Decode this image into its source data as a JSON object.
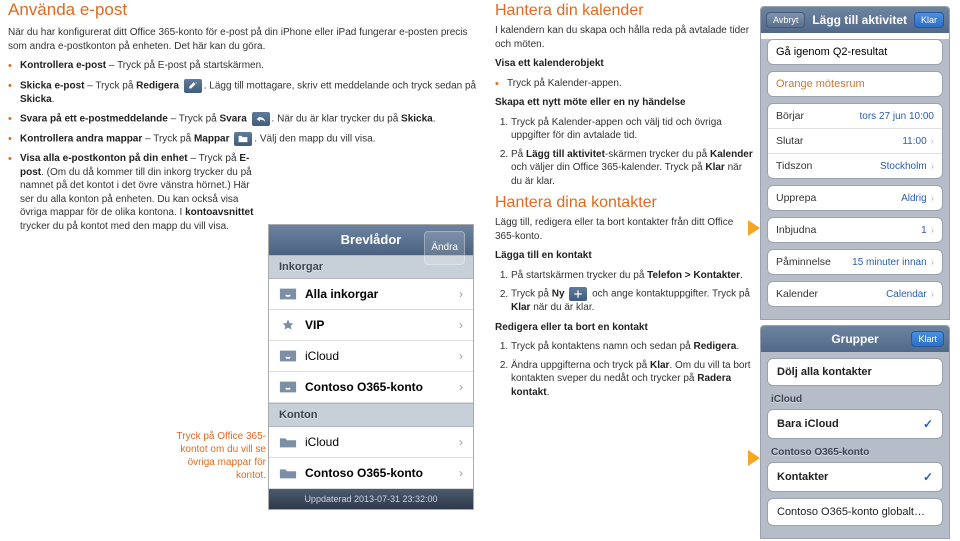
{
  "left": {
    "title": "Använda e-post",
    "intro": "När du har konfigurerat ditt Office 365-konto för e-post på din iPhone eller iPad fungerar e-posten precis som andra e-postkonton på enheten. Det här kan du göra.",
    "b1_a": "Kontrollera e-post",
    "b1_b": " – Tryck på E-post på startskärmen.",
    "b2_a": "Skicka e-post",
    "b2_b": " – Tryck på ",
    "b2_c": "Redigera",
    "b2_d": ". Lägg till mottagare, skriv ett meddelande och tryck sedan på ",
    "b2_e": "Skicka",
    "b2_f": ".",
    "b3_a": "Svara på ett e-postmeddelande",
    "b3_b": " – Tryck på ",
    "b3_c": "Svara",
    "b3_d": ". När du är klar trycker du på ",
    "b3_e": "Skicka",
    "b3_f": ".",
    "b4_a": "Kontrollera andra mappar",
    "b4_b": " – Tryck på ",
    "b4_c": "Mappar",
    "b4_d": ". Välj den mapp du vill visa.",
    "b5_a": "Visa alla e-postkonton på din enhet",
    "b5_b": " – Tryck på ",
    "b5_c": "E-post",
    "b5_d": ". (Om du då kommer till din inkorg trycker du på namnet på det kontot i det övre vänstra hörnet.) Här ser du alla konton på enheten. Du kan också visa övriga mappar för de olika kontona. I ",
    "b5_e": "kontoavsnittet",
    "b5_f": " trycker du på kontot med den mapp du vill visa.",
    "callout": "Tryck på Office 365-kontot om du vill se övriga mappar för kontot."
  },
  "mailboxes": {
    "title": "Brevlådor",
    "edit": "Ändra",
    "sec1": "Inkorgar",
    "rows1": [
      "Alla inkorgar",
      "VIP",
      "iCloud",
      "Contoso O365-konto"
    ],
    "sec2": "Konton",
    "rows2": [
      "iCloud",
      "Contoso O365-konto"
    ],
    "footer": "Uppdaterad 2013-07-31 23:32:00"
  },
  "mid": {
    "h1a": "Hantera din kalender",
    "p1": "I kalendern kan du skapa och hålla reda på avtalade tider och möten.",
    "s1": "Visa ett kalenderobjekt",
    "li1": "Tryck på Kalender-appen.",
    "s2": "Skapa ett nytt möte eller en ny händelse",
    "ol1_1": "Tryck på Kalender-appen och välj tid och övriga uppgifter för din avtalade tid.",
    "ol1_2a": "På ",
    "ol1_2b": "Lägg till aktivitet",
    "ol1_2c": "-skärmen trycker du på ",
    "ol1_2d": "Kalender",
    "ol1_2e": " och väljer din Office 365-kalender. Tryck på ",
    "ol1_2f": "Klar",
    "ol1_2g": " när du är klar.",
    "h1b": "Hantera dina kontakter",
    "p2": "Lägg till, redigera eller ta bort kontakter från ditt Office 365-konto.",
    "s3": "Lägga till en kontakt",
    "ol2_1a": "På startskärmen trycker du på ",
    "ol2_1b": "Telefon > Kontakter",
    "ol2_1c": ".",
    "ol2_2a": "Tryck på ",
    "ol2_2b": "Ny",
    "ol2_2c": " och ange kontaktuppgifter. Tryck på ",
    "ol2_2d": "Klar",
    "ol2_2e": " när du är klar.",
    "s4": "Redigera eller ta bort en kontakt",
    "ol3_1a": "Tryck på kontaktens namn och sedan på ",
    "ol3_1b": "Redigera",
    "ol3_1c": ".",
    "ol3_2a": "Ändra uppgifterna och tryck på ",
    "ol3_2b": "Klar",
    "ol3_2c": ". Om du vill ta bort kontakten sveper du nedåt och trycker på ",
    "ol3_2d": "Radera kontakt",
    "ol3_2e": "."
  },
  "activity": {
    "cancel": "Avbryt",
    "title": "Lägg till aktivitet",
    "done": "Klar",
    "field1": "Gå igenom Q2-resultat",
    "field2": "Orange mötesrum",
    "rows1": [
      {
        "l": "Börjar",
        "r": "tors 27 jun 10:00"
      },
      {
        "l": "Slutar",
        "r": "11:00"
      },
      {
        "l": "Tidszon",
        "r": "Stockholm"
      }
    ],
    "row_repeat": {
      "l": "Upprepa",
      "r": "Aldrig"
    },
    "row_invite": {
      "l": "Inbjudna",
      "r": "1"
    },
    "row_remind": {
      "l": "Påminnelse",
      "r": "15 minuter innan"
    },
    "row_cal": {
      "l": "Kalender",
      "r": "Calendar"
    }
  },
  "groups": {
    "title": "Grupper",
    "done": "Klart",
    "hide": "Dölj alla kontakter",
    "sec1": "iCloud",
    "row1": "Bara iCloud",
    "sec2": "Contoso O365-konto",
    "row2": "Kontakter",
    "row3": "Contoso O365-konto globalt…"
  }
}
